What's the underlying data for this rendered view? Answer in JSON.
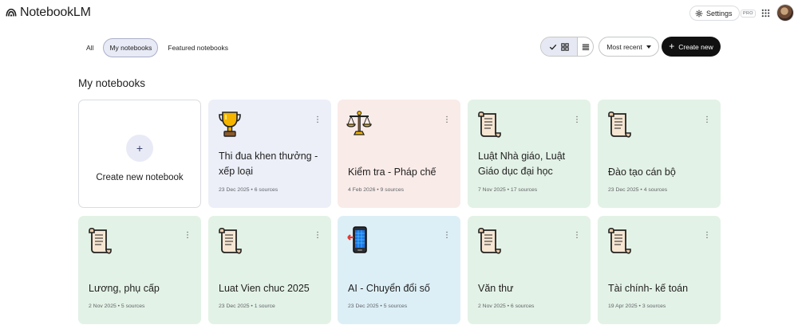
{
  "app": {
    "name": "NotebookLM"
  },
  "header": {
    "settings_label": "Settings",
    "pro_label": "PRO"
  },
  "filters": [
    {
      "label": "All",
      "active": false
    },
    {
      "label": "My notebooks",
      "active": true
    },
    {
      "label": "Featured notebooks",
      "active": false
    }
  ],
  "toolbar": {
    "sort_label": "Most recent",
    "create_label": "Create new"
  },
  "section": {
    "title": "My notebooks"
  },
  "new_notebook": {
    "label": "Create new notebook"
  },
  "notebooks": [
    {
      "title": "Thi đua khen thưởng - xếp loại",
      "meta": "23 Dec 2025 • 6 sources",
      "icon": "trophy-icon",
      "color": "#eceff8"
    },
    {
      "title": "Kiểm tra - Pháp chế",
      "meta": "4 Feb 2026 • 9 sources",
      "icon": "scales-icon",
      "color": "#f9ebe8"
    },
    {
      "title": "Luật Nhà giáo, Luật Giáo dục đại học",
      "meta": "7 Nov 2025 • 17 sources",
      "icon": "scroll-icon",
      "color": "#e3f2e6"
    },
    {
      "title": "Đào tạo cán bộ",
      "meta": "23 Dec 2025 • 4 sources",
      "icon": "scroll-icon",
      "color": "#e3f2e6"
    },
    {
      "title": "Lương, phụ cấp",
      "meta": "2 Nov 2025 • 5 sources",
      "icon": "scroll-icon",
      "color": "#e3f2e6"
    },
    {
      "title": "Luat Vien chuc 2025",
      "meta": "23 Dec 2025 • 1 source",
      "icon": "scroll-icon",
      "color": "#e3f2e6"
    },
    {
      "title": "AI - Chuyển đổi số",
      "meta": "23 Dec 2025 • 5 sources",
      "icon": "mobile-phone-icon",
      "color": "#ddeff6"
    },
    {
      "title": "Văn thư",
      "meta": "2 Nov 2025 • 6 sources",
      "icon": "scroll-icon",
      "color": "#e3f2e6"
    },
    {
      "title": "Tài chính- kế toán",
      "meta": "19 Apr 2025 • 3 sources",
      "icon": "scroll-icon",
      "color": "#e3f2e6"
    }
  ]
}
